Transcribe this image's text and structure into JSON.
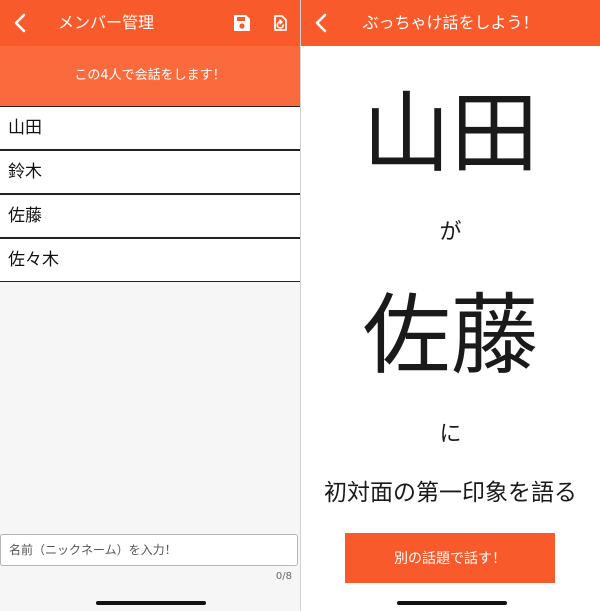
{
  "left": {
    "header": {
      "title": "メンバー管理",
      "back_icon": "chevron-left-icon",
      "save_icon": "save-icon",
      "reset_icon": "reset-icon"
    },
    "banner_text": "この4人で会話をします！",
    "members": [
      "山田",
      "鈴木",
      "佐藤",
      "佐々木"
    ],
    "input": {
      "placeholder": "名前（ニックネーム）を入力！",
      "value": ""
    },
    "counter": "0/8"
  },
  "right": {
    "header": {
      "title": "ぶっちゃけ話をしよう！",
      "back_icon": "chevron-left-icon"
    },
    "speaker": "山田",
    "particle_ga": "が",
    "listener": "佐藤",
    "particle_ni": "に",
    "topic": "初対面の第一印象を語る",
    "next_button": "別の話題で話す！"
  },
  "colors": {
    "accent": "#f85a2b",
    "banner": "#fa6a3c"
  }
}
